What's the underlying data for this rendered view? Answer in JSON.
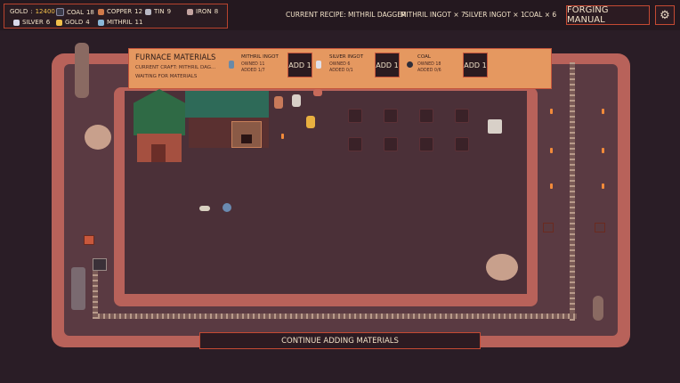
{
  "resources": [
    {
      "name": "GOLD",
      "value": "12400",
      "color": "#f2c04a",
      "icon": "coin-icon"
    },
    {
      "name": "COAL",
      "value": "18",
      "color": "#3b3b4a",
      "icon": "coal-icon"
    },
    {
      "name": "COPPER",
      "value": "12",
      "color": "#d07a4a",
      "icon": "copper-ore-icon"
    },
    {
      "name": "TIN",
      "value": "9",
      "color": "#b8b8c4",
      "icon": "tin-ore-icon"
    },
    {
      "name": "IRON",
      "value": "8",
      "color": "#c4a4a0",
      "icon": "iron-ore-icon"
    },
    {
      "name": "SILVER",
      "value": "6",
      "color": "#d8d8e8",
      "icon": "silver-ore-icon"
    },
    {
      "name": "GOLD",
      "value": "4",
      "color": "#f2c04a",
      "icon": "gold-ore-icon"
    },
    {
      "name": "MITHRIL",
      "value": "11",
      "color": "#8ab8d8",
      "icon": "mithril-ore-icon"
    }
  ],
  "recipe_bar": {
    "current": "CURRENT RECIPE: MITHRIL DAGGER",
    "req1": "MITHRIL INGOT × 7",
    "req2": "SILVER INGOT × 1",
    "req3": "COAL × 6"
  },
  "buttons": {
    "manual": "FORGING MANUAL",
    "settings_icon": "gear-icon",
    "continue": "CONTINUE ADDING MATERIALS"
  },
  "panel": {
    "title": "FURNACE MATERIALS",
    "current_craft": "CURRENT CRAFT: MITHRIL DAG...",
    "status": "WAITING FOR MATERIALS",
    "materials": [
      {
        "name": "MITHRIL INGOT",
        "owned": "OWNED 11",
        "added": "ADDED 1/7",
        "add_label": "ADD 1",
        "color": "#6a8aa8",
        "icon": "mithril-ingot-icon"
      },
      {
        "name": "SILVER INGOT",
        "owned": "OWNED 6",
        "added": "ADDED 0/1",
        "add_label": "ADD 1",
        "color": "#e0e0ea",
        "icon": "silver-ingot-icon"
      },
      {
        "name": "COAL",
        "owned": "OWNED 18",
        "added": "ADDED 0/6",
        "add_label": "ADD 1",
        "color": "#2e2e3a",
        "icon": "coal-icon"
      }
    ]
  },
  "colors": {
    "accent": "#c54a33",
    "panel_bg": "#e59860",
    "floor": "#5a3a42",
    "wall": "#b8625a"
  }
}
